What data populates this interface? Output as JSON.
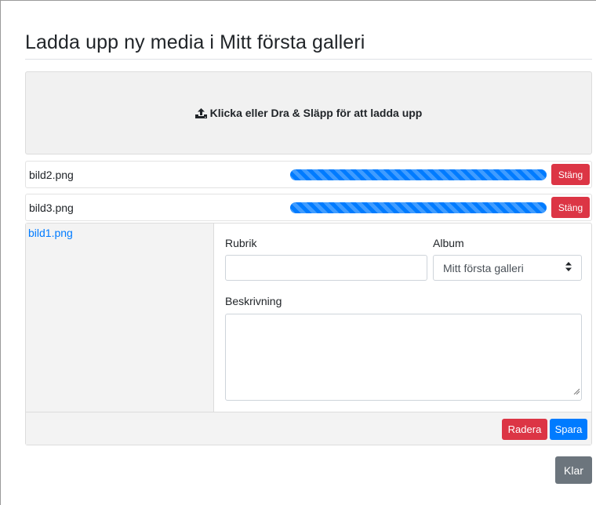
{
  "title": "Ladda upp ny media i Mitt första galleri",
  "dropzone": {
    "icon": "upload-icon",
    "label": "Klicka eller Dra & Släpp för att ladda upp"
  },
  "uploads": [
    {
      "filename": "bild2.png",
      "progress": 1.0,
      "close_label": "Stäng"
    },
    {
      "filename": "bild3.png",
      "progress": 1.0,
      "close_label": "Stäng"
    }
  ],
  "editor": {
    "filename": "bild1.png",
    "rubrik_label": "Rubrik",
    "rubrik_value": "",
    "album_label": "Album",
    "album_selected": "Mitt första galleri",
    "beskrivning_label": "Beskrivning",
    "beskrivning_value": "",
    "delete_label": "Radera",
    "save_label": "Spara"
  },
  "done_label": "Klar",
  "colors": {
    "primary": "#007bff",
    "danger": "#dc3545",
    "secondary": "#6c757d",
    "panel": "#f3f3f3"
  }
}
